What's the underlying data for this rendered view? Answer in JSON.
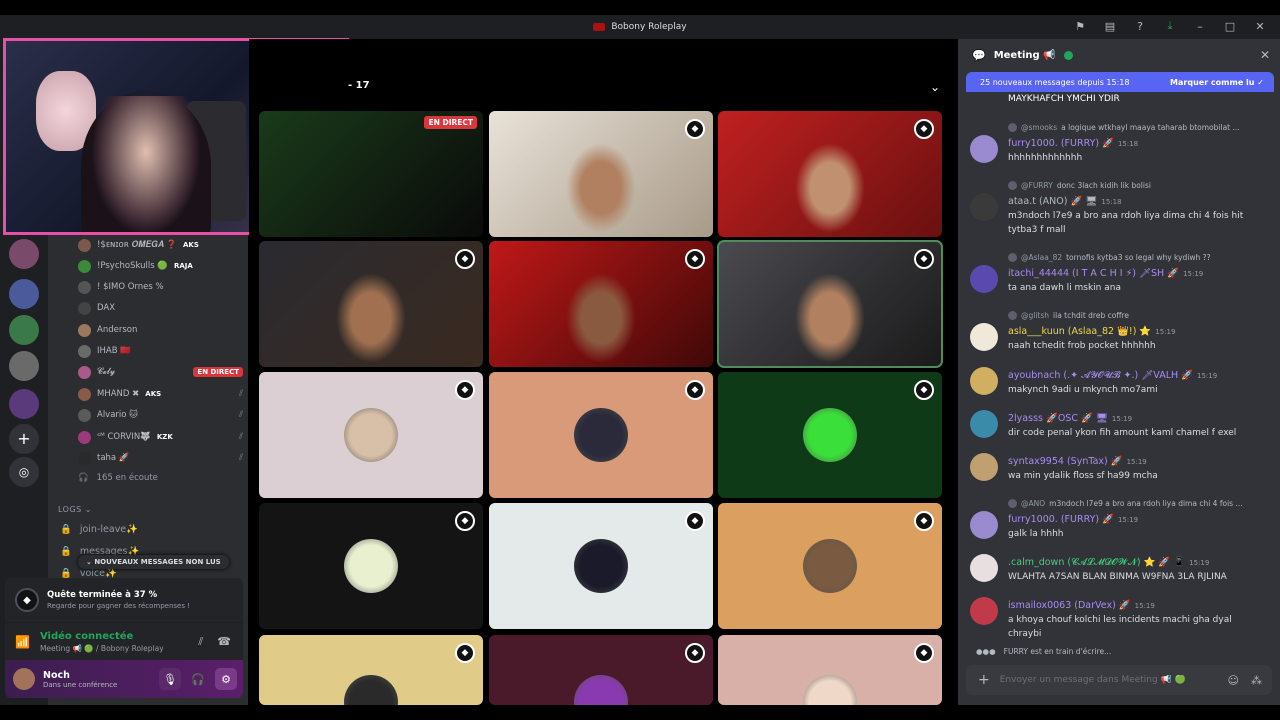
{
  "window": {
    "title": "Bobony Roleplay",
    "icons": [
      "flag-icon",
      "inbox-icon",
      "help-icon",
      "download-icon",
      "minimize-icon",
      "maximize-icon",
      "close-icon"
    ]
  },
  "voice_users": [
    {
      "name": "!$ᴇɴɪᴏʀ 𝑶𝑴𝑬𝑮𝑨 ❓",
      "tag": "AKS",
      "color": "#7a5a4a"
    },
    {
      "name": "!PsychoSkulls 🟢",
      "tag": "RAJA",
      "color": "#3a8a3a"
    },
    {
      "name": "! $IMO Ornes %",
      "tag": "",
      "color": "#555"
    },
    {
      "name": "DAX",
      "tag": "",
      "color": "#444"
    },
    {
      "name": "Anderson",
      "tag": "",
      "color": "#9a7a5a"
    },
    {
      "name": "IHAB 🇲🇦",
      "tag": "",
      "color": "#6a6a6a"
    },
    {
      "name": "𝓒𝓮𝓵𝔂",
      "tag": "",
      "color": "#aa5a8a",
      "live": "EN DIRECT"
    },
    {
      "name": "MHAND ✖",
      "tag": "AKS",
      "color": "#8a5a4a"
    },
    {
      "name": "Alvario 🐱",
      "tag": "",
      "color": "#5a5a5a"
    },
    {
      "name": "ˢᴹ CORVIN🐺",
      "tag": "KZK",
      "color": "#9a3a7a"
    },
    {
      "name": "taha 🚀",
      "tag": "",
      "color": "#2a2a2a"
    }
  ],
  "listening": "165 en écoute",
  "logs_label": "LOGS",
  "channels": [
    "join-leave✨",
    "messages✨",
    "voice✨"
  ],
  "new_messages_pill": "NOUVEAUX MESSAGES NON LUS",
  "quest": {
    "title": "Quête terminée à 37 %",
    "subtitle": "Regarde pour gagner des récompenses !"
  },
  "voice_status": {
    "title": "Vidéo connectée",
    "subtitle": "Meeting 📢 🟢 / Bobony Roleplay"
  },
  "user": {
    "name": "Noch",
    "status": "Dans une conférence"
  },
  "stage": {
    "count_label": "- 17",
    "live_badge": "EN DIRECT"
  },
  "chat": {
    "title": "Meeting 📢",
    "banner_text": "25 nouveaux messages depuis 15:18",
    "banner_action": "Marquer comme lu",
    "typing": "FURRY est en train d'écrire...",
    "composer_placeholder": "Envoyer un message dans Meeting 📢 🟢",
    "messages": [
      {
        "reply": "",
        "author": "",
        "time": "",
        "text": "MAYKHAFCH YMCHI YDIR",
        "color": "#fff"
      },
      {
        "reply_author": "@smooks",
        "reply": "a logique  wtkhayl maaya taharab btomobilat ...",
        "author": "furry1000. (FURRY) 🚀",
        "time": "15:18",
        "text": "hhhhhhhhhhhhh",
        "color": "#a98cf0"
      },
      {
        "reply_author": "@FURRY",
        "reply": "donc 3lach kidih lik bolisi",
        "author": "ataa.t (ANO) 🚀 🖥",
        "time": "15:18",
        "text": "m3ndoch l7e9 a bro ana rdoh liya dima chi 4 fois hit",
        "text2": "tytba3 f mall",
        "color": "#b5bac1"
      },
      {
        "reply_author": "@Aslaa_82",
        "reply": "tornofis kytba3 so legal why kydiwh ??",
        "author": "itachi_44444 (I T A C H I ⚡) 🗡SH 🚀",
        "time": "15:19",
        "text": "ta ana dawh li mskin ana",
        "color": "#a98cf0"
      },
      {
        "reply_author": "@glitsh",
        "reply": "ila tchdit dreb coffre",
        "author": "asla___kuun (Aslaa_82 👑!) ⭐",
        "time": "15:19",
        "text": "naah tchedit frob pocket hhhhhh",
        "color": "#f0d848"
      },
      {
        "reply_author": "",
        "reply": "",
        "author": "ayoubnach (.✦ 𝓐𝓨𝓞𝓤𝓑 ✦.) 🗡VALH 🚀",
        "time": "15:19",
        "text": "makynch 9adi u mkynch mo7ami",
        "color": "#a98cf0"
      },
      {
        "reply_author": "",
        "reply": "",
        "author": "2lyasss 🚀OSC 🚀 🖥",
        "time": "15:19",
        "text": "dir code penal ykon fih amount kaml chamel f exel",
        "color": "#a98cf0"
      },
      {
        "reply_author": "",
        "reply": "",
        "author": "syntax9954 (SynTax) 🚀",
        "time": "15:19",
        "text": "wa min ydalik floss sf ha99 mcha",
        "color": "#a98cf0"
      },
      {
        "reply_author": "@ANO",
        "reply": "m3ndoch l7e9 a bro ana rdoh liya dima chi 4 fois ...",
        "author": "furry1000. (FURRY) 🚀",
        "time": "15:19",
        "text": "galk la hhhh",
        "color": "#a98cf0"
      },
      {
        "reply_author": "",
        "reply": "",
        "author": ".calm_down (𝓒𝓐𝓛𝓜𝓓𝓞𝓦𝓝) ⭐ 🚀 📱",
        "time": "15:19",
        "text": "WLAHTA A7SAN BLAN BINMA W9FNA 3LA RJLINA",
        "color": "#3fd47a"
      },
      {
        "reply_author": "",
        "reply": "",
        "author": "ismailox0063 (DarVex) 🚀",
        "time": "15:19",
        "text": "a khoya chouf kolchi les incidents machi gha dyal",
        "text2": "chraybi",
        "color": "#a98cf0"
      }
    ]
  },
  "colors": {
    "accent": "#5865f2",
    "live": "#da373c",
    "online": "#23a55a",
    "cam_border": "#e84fa6"
  }
}
